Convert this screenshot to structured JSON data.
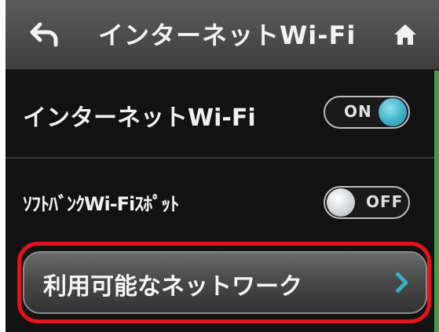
{
  "header": {
    "title": "インターネットWi-Fi",
    "back_icon": "back-arrow-icon",
    "home_icon": "home-icon"
  },
  "settings": [
    {
      "label": "インターネットWi-Fi",
      "toggle_state": "ON",
      "toggle_color": "#3aaec4"
    },
    {
      "label": "ｿﾌﾄﾊﾞﾝｸWi-Fiｽﾎﾟｯﾄ",
      "toggle_state": "OFF"
    }
  ],
  "networks_button": {
    "label": "利用可能なネットワーク",
    "icon": "chevron-right-icon"
  },
  "colors": {
    "highlight": "#e8101a",
    "scrollbar": "#3ea040",
    "chevron": "#3aaec4"
  }
}
